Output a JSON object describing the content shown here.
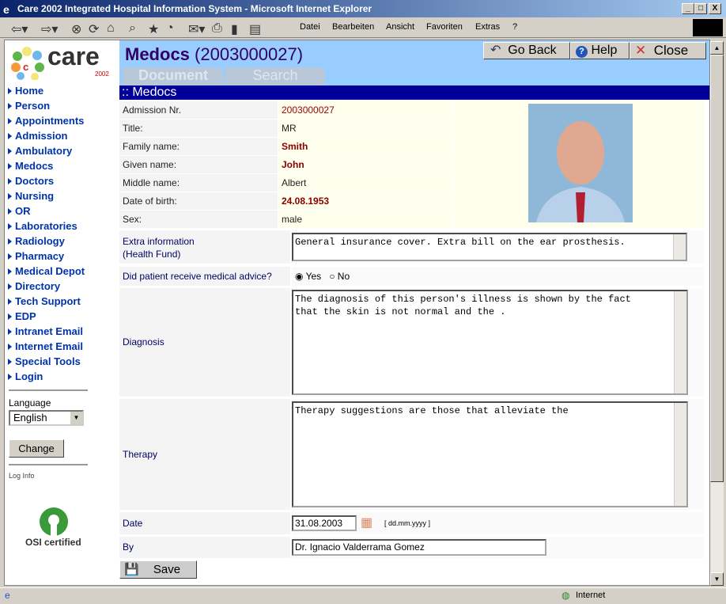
{
  "window": {
    "title": "Care 2002 Integrated Hospital Information System - Microsoft Internet Explorer"
  },
  "menu": [
    "Datei",
    "Bearbeiten",
    "Ansicht",
    "Favoriten",
    "Extras",
    "?"
  ],
  "logo": {
    "text": "care",
    "year": "2002"
  },
  "sidebar": {
    "items": [
      "Home",
      "Person",
      "Appointments",
      "Admission",
      "Ambulatory",
      "Medocs",
      "Doctors",
      "Nursing",
      "OR",
      "Laboratories",
      "Radiology",
      "Pharmacy",
      "Medical Depot",
      "Directory",
      "Tech Support",
      "EDP",
      "Intranet Email",
      "Internet Email",
      "Special Tools",
      "Login"
    ],
    "language_label": "Language",
    "language_value": "English",
    "change_label": "Change",
    "log_info": "Log Info",
    "osi": "OSI certified"
  },
  "header": {
    "title": "Medocs",
    "number": "(2003000027)",
    "go_back": "Go Back",
    "help": "Help",
    "close": "Close",
    "tabs": [
      "Document",
      "Search"
    ],
    "section": ":: Medocs"
  },
  "patient": [
    {
      "label": "Admission Nr.",
      "value": "2003000027",
      "style": "red"
    },
    {
      "label": "Title:",
      "value": "MR",
      "style": "plain"
    },
    {
      "label": "Family name:",
      "value": "Smith",
      "style": "bold"
    },
    {
      "label": "Given name:",
      "value": "John",
      "style": "bold"
    },
    {
      "label": "Middle name:",
      "value": "Albert",
      "style": "plain"
    },
    {
      "label": "Date of birth:",
      "value": "24.08.1953",
      "style": "bold"
    },
    {
      "label": "Sex:",
      "value": "male",
      "style": "plain"
    }
  ],
  "form": {
    "extra_label1": "Extra information",
    "extra_label2": "(Health Fund)",
    "extra_value": "General insurance cover. Extra bill on the ear prosthesis.",
    "advice_label": "Did patient receive medical advice?",
    "advice_yes": "Yes",
    "advice_no": "No",
    "advice_selected": "Yes",
    "diagnosis_label": "Diagnosis",
    "diagnosis_value": "The diagnosis of this person's illness is shown by the fact\nthat the skin is not normal and the .",
    "therapy_label": "Therapy",
    "therapy_value": "Therapy suggestions are those that alleviate the",
    "date_label": "Date",
    "date_value": "31.08.2003",
    "date_format": "[ dd.mm.yyyy ]",
    "by_label": "By",
    "by_value": "Dr. Ignacio Valderrama Gomez",
    "save": "Save"
  },
  "status": {
    "zone": "Internet"
  }
}
